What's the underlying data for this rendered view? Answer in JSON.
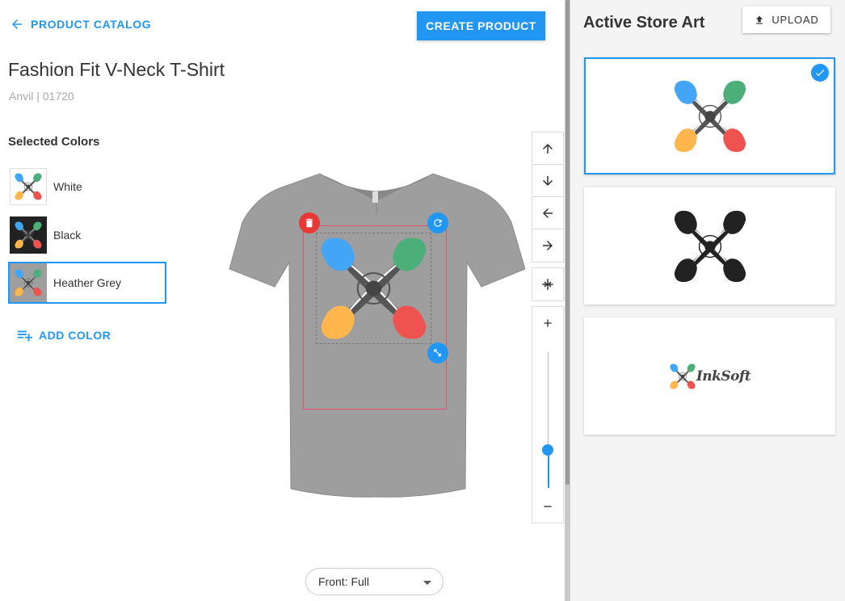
{
  "header": {
    "back_label": "PRODUCT CATALOG",
    "create_label": "CREATE PRODUCT"
  },
  "product": {
    "title": "Fashion Fit V-Neck T-Shirt",
    "subtitle": "Anvil | 01720"
  },
  "colors": {
    "heading": "Selected Colors",
    "items": [
      {
        "label": "White",
        "swatch": "#ffffff"
      },
      {
        "label": "Black",
        "swatch": "#222222"
      },
      {
        "label": "Heather Grey",
        "swatch": "#9e9e9e",
        "selected": true
      }
    ],
    "add_label": "ADD COLOR"
  },
  "view": {
    "selected": "Front: Full"
  },
  "zoom": {
    "level": 0.28
  },
  "art": {
    "title": "Active Store Art",
    "upload_label": "UPLOAD",
    "items": [
      {
        "name": "color-logo",
        "selected": true
      },
      {
        "name": "black-logo",
        "selected": false
      },
      {
        "name": "inksoft-logo",
        "text": "InkSoft",
        "selected": false
      }
    ]
  },
  "theme": {
    "accent": "#2196f3",
    "danger": "#e53935",
    "logo_blue": "#42a5f5",
    "logo_green": "#4caf7a",
    "logo_orange": "#ffb74d",
    "logo_red": "#ef5350",
    "shirt_grey": "#9e9e9e"
  }
}
